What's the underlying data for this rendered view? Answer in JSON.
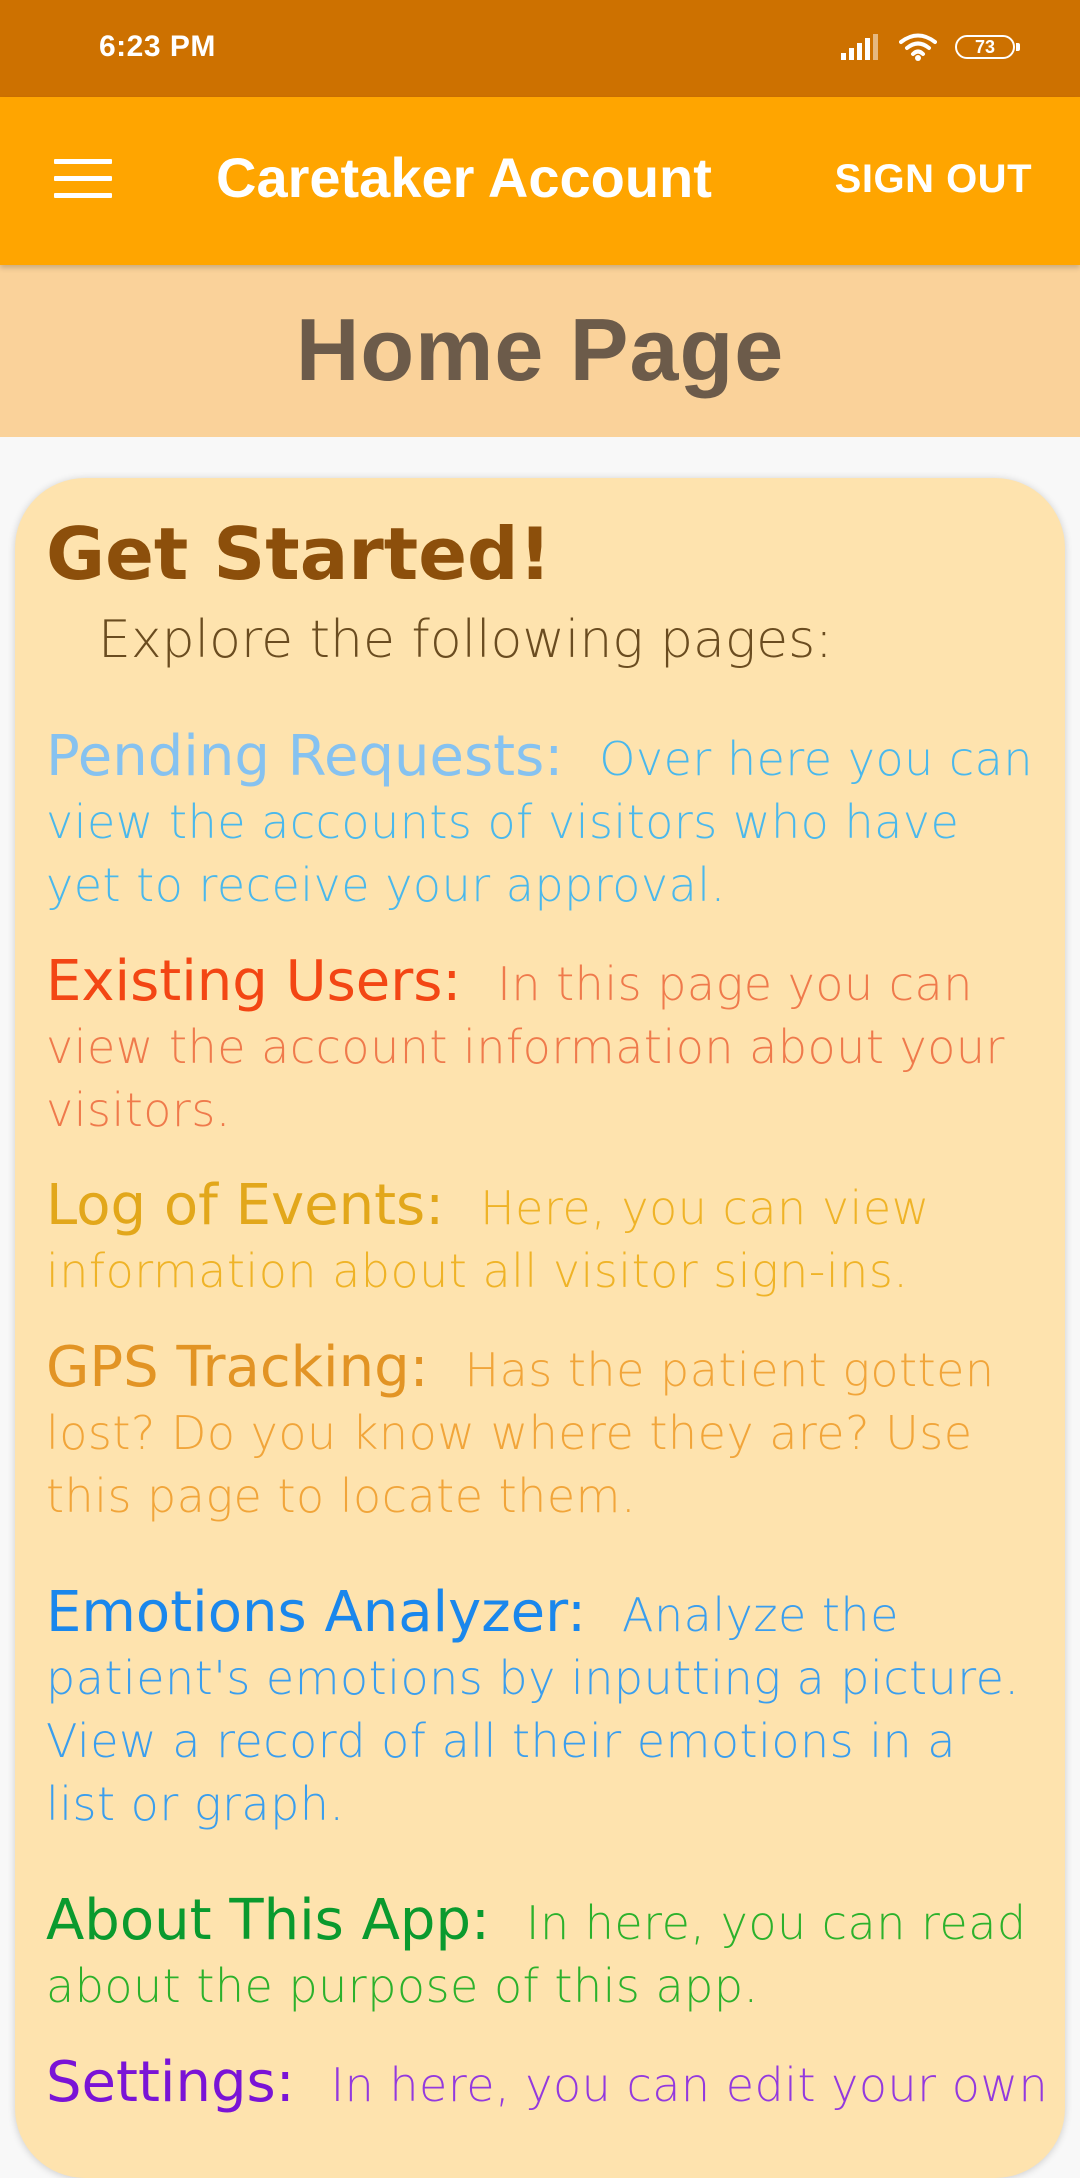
{
  "status_bar": {
    "time": "6:23 PM",
    "battery_level": "73",
    "icons": [
      "signal-icon",
      "wifi-icon",
      "battery-icon"
    ]
  },
  "app_bar": {
    "menu_icon": "hamburger-menu-icon",
    "title": "Caretaker Account",
    "sign_out_label": "SIGN OUT"
  },
  "page": {
    "title": "Home Page"
  },
  "card": {
    "heading": "Get Started!",
    "subheading": "Explore the following pages:",
    "sections": [
      {
        "label": "Pending Requests:",
        "description": "Over here you can\nview the accounts of visitors who have\nyet to receive your approval."
      },
      {
        "label": "Existing Users:",
        "description": "In this page you can\nview the account information about your\nvisitors."
      },
      {
        "label": "Log of Events:",
        "description": "Here, you can view\ninformation about all visitor sign-ins."
      },
      {
        "label": "GPS Tracking:",
        "description": "Has the patient gotten\nlost? Do you know where they are? Use\nthis page to locate them."
      },
      {
        "label": "Emotions Analyzer:",
        "description": "Analyze the\npatient's emotions by inputting a picture.\nView a record of all their emotions in a\nlist or graph."
      },
      {
        "label": "About This App:",
        "description": "In here, you can read\nabout the purpose of this app."
      },
      {
        "label": "Settings:",
        "description": "In here, you can edit your own"
      }
    ]
  },
  "colors": {
    "status_bar": "#cd7100",
    "app_bar": "#ffa500",
    "page_header": "#fad29a",
    "card_background": "#fee3ae"
  }
}
